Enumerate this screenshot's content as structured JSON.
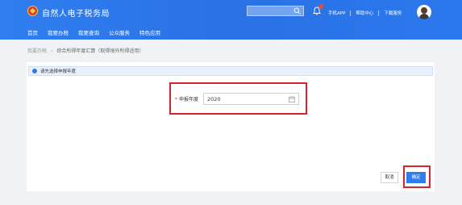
{
  "header": {
    "site_title": "自然人电子税务局",
    "search": {
      "placeholder": ""
    },
    "links": [
      "手机APP",
      "帮助中心",
      "下载服务"
    ]
  },
  "nav": {
    "items": [
      "首页",
      "我要办税",
      "我要查询",
      "公众服务",
      "特色应用"
    ]
  },
  "breadcrumb": {
    "parent": "我要办税",
    "current": "综合所得年度汇算（取得境外所得适用）"
  },
  "notice": {
    "text": "请先选择申报年度"
  },
  "form": {
    "required_mark": "*",
    "year_label": "申报年度",
    "year_value": "2020"
  },
  "actions": {
    "cancel_label": "取消",
    "confirm_label": "确定"
  },
  "colors": {
    "brand": "#2f7ef0",
    "highlight": "#d9222a"
  }
}
